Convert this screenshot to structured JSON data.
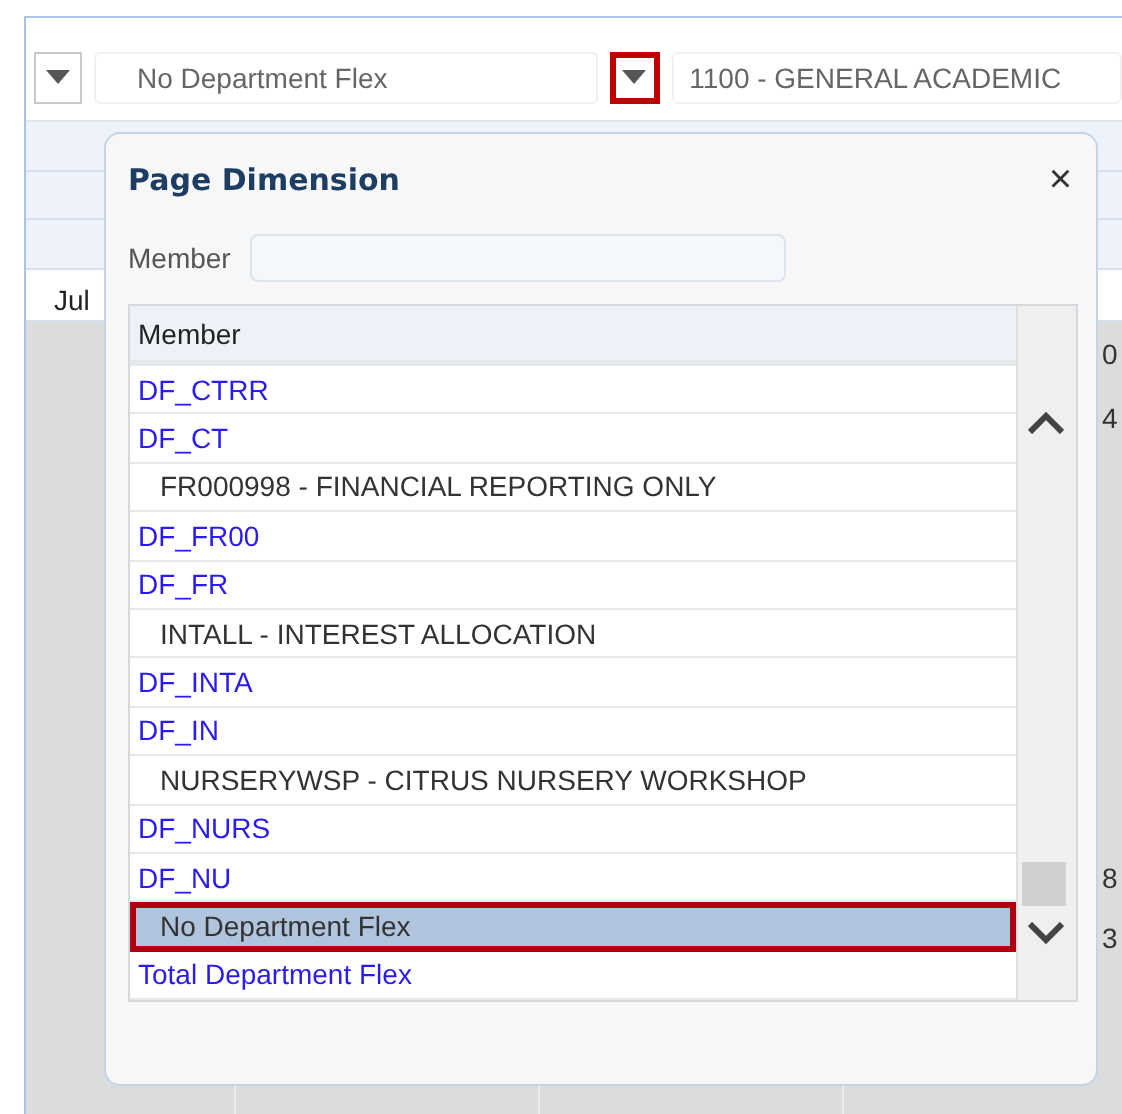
{
  "toolbar": {
    "department": {
      "value": "No Department Flex"
    },
    "fund": {
      "value": "1100 - GENERAL ACADEMIC"
    }
  },
  "grid": {
    "header_cell": "Jul",
    "row_values": [
      "0",
      "4",
      "8",
      "3"
    ]
  },
  "dialog": {
    "title": "Page Dimension",
    "close": "×",
    "search": {
      "label": "Member"
    },
    "list": {
      "column": "Member",
      "items": [
        {
          "label": "DF_CTRR",
          "kind": "group",
          "selected": false
        },
        {
          "label": "DF_CT",
          "kind": "group",
          "selected": false
        },
        {
          "label": "FR000998 - FINANCIAL REPORTING ONLY",
          "kind": "member",
          "selected": false
        },
        {
          "label": "DF_FR00",
          "kind": "group",
          "selected": false
        },
        {
          "label": "DF_FR",
          "kind": "group",
          "selected": false
        },
        {
          "label": "INTALL - INTEREST ALLOCATION",
          "kind": "member",
          "selected": false
        },
        {
          "label": "DF_INTA",
          "kind": "group",
          "selected": false
        },
        {
          "label": "DF_IN",
          "kind": "group",
          "selected": false
        },
        {
          "label": "NURSERYWSP - CITRUS NURSERY WORKSHOP",
          "kind": "member",
          "selected": false
        },
        {
          "label": "DF_NURS",
          "kind": "group",
          "selected": false
        },
        {
          "label": "DF_NU",
          "kind": "group",
          "selected": false
        },
        {
          "label": "No Department Flex",
          "kind": "member",
          "selected": true
        },
        {
          "label": "Total Department Flex",
          "kind": "group",
          "selected": false
        }
      ]
    }
  }
}
